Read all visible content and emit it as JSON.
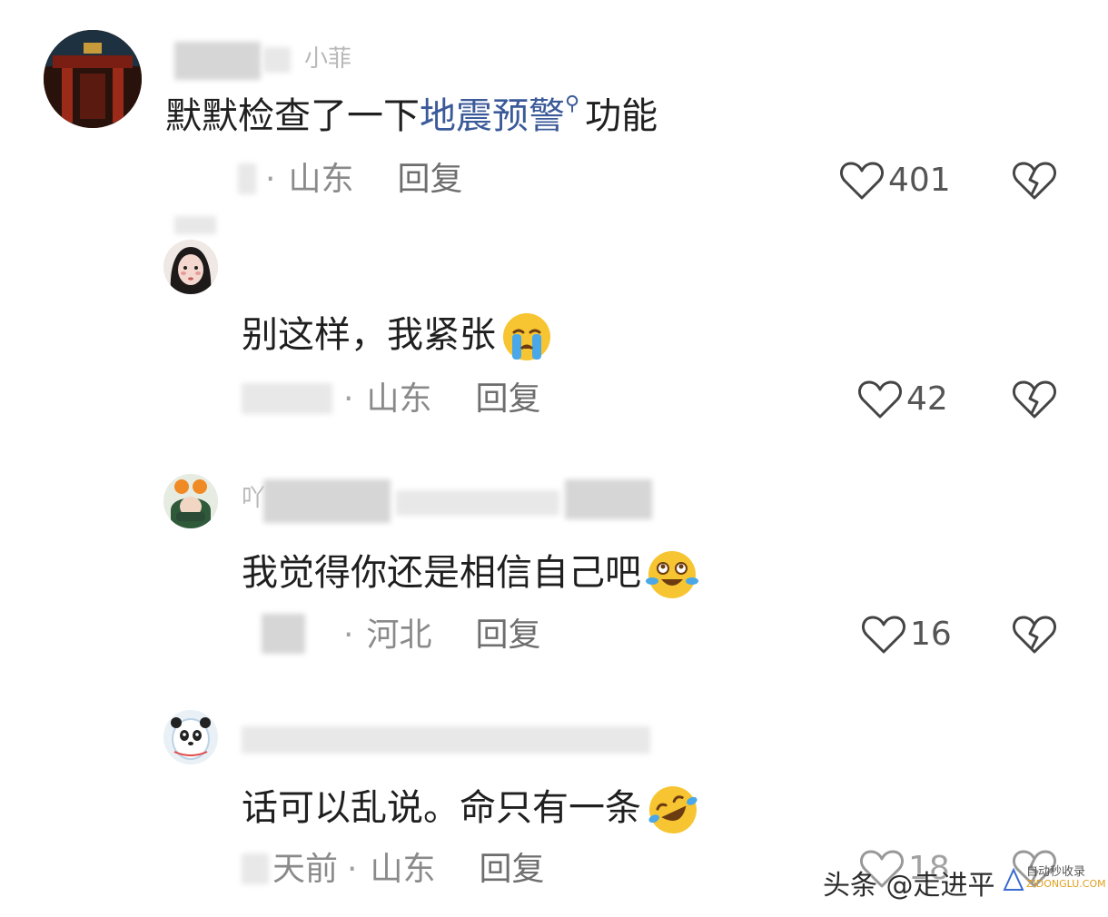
{
  "comments": [
    {
      "username_partial": "小菲",
      "text_before": "默默检查了一下",
      "link_text": "地震预警",
      "text_after": "功能",
      "location": "山东",
      "reply_label": "回复",
      "likes": "401",
      "avatar": "temple-photo-avatar"
    },
    {
      "text": "别这样，我紧张",
      "emoji": "loudly-crying-face",
      "location": "山东",
      "reply_label": "回复",
      "likes": "42",
      "avatar": "girl-photo-avatar"
    },
    {
      "username_partial": "吖",
      "text": "我觉得你还是相信自己吧",
      "emoji": "crying-laughing-face",
      "location": "河北",
      "reply_label": "回复",
      "likes": "16",
      "avatar": "orange-hat-avatar"
    },
    {
      "text": "话可以乱说。命只有一条",
      "emoji": "rolling-laughing-face",
      "time_partial": "天前",
      "location": "山东",
      "reply_label": "回复",
      "likes": "18",
      "avatar": "panda-mascot-avatar"
    }
  ],
  "watermark": {
    "text": "头条 @走进平",
    "logo_line1": "自动秒收录",
    "logo_line2": "ZIDONGLU.COM"
  },
  "icons": {
    "like": "heart-outline-icon",
    "dislike": "broken-heart-icon",
    "search": "search-icon"
  },
  "colors": {
    "link": "#3b5a99",
    "meta_text": "#8a8a8a",
    "body_text": "#1f1f1f"
  }
}
